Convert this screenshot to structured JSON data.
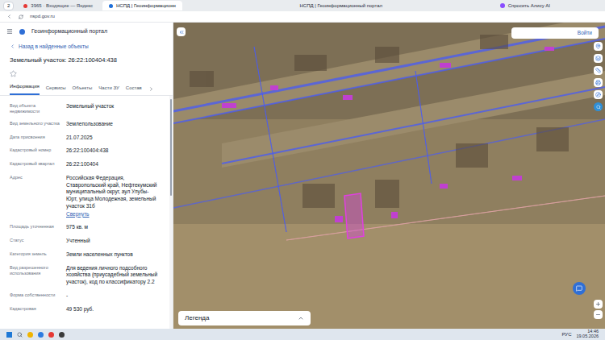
{
  "browser": {
    "tab_count": "2",
    "tabs": [
      {
        "label": "3965 · Входящие — Яндекс",
        "selected": false
      },
      {
        "label": "НСПД | Геоинформационн",
        "selected": true
      }
    ],
    "page_title": "НСПД | Геоинформационный портал",
    "alice": "Спросить Алису AI",
    "address": "nspd.gov.ru"
  },
  "app": {
    "title": "Геоинформационный портал",
    "back": "Назад в найденные объекты",
    "object_title": "Земельный участок: 26:22:100404:438",
    "starred": false,
    "tabs": [
      {
        "label": "Информация",
        "selected": true
      },
      {
        "label": "Сервисы",
        "selected": false
      },
      {
        "label": "Объекты",
        "selected": false
      },
      {
        "label": "Части ЗУ",
        "selected": false
      },
      {
        "label": "Состав",
        "selected": false
      }
    ],
    "fields": [
      {
        "label": "Вид объекта недвижимости",
        "value": "Земельный участок"
      },
      {
        "label": "Вид земельного участка",
        "value": "Землепользование"
      },
      {
        "label": "Дата присвоения",
        "value": "21.07.2025"
      },
      {
        "label": "Кадастровый номер",
        "value": "26:22:100404:438"
      },
      {
        "label": "Кадастровый квартал",
        "value": "26:22:100404"
      },
      {
        "label": "Адрес",
        "value": "Российская Федерация, Ставропольский край, Нефтекумский муниципальный округ, аул Улубы-Юрт, улица Молодежная, земельный участок 31б",
        "link": "Свернуть"
      },
      {
        "label": "Площадь уточненная",
        "value": "975 кв. м"
      },
      {
        "label": "Статус",
        "value": "Учтенный"
      },
      {
        "label": "Категория земель",
        "value": "Земли населенных пунктов"
      },
      {
        "label": "Вид разрешенного использования",
        "value": "Для ведения личного подсобного хозяйства (приусадебный земельный участок), код по классификатору 2.2"
      },
      {
        "label": "Форма собственности",
        "value": "-"
      },
      {
        "label": "Кадастровая",
        "value": "49 530 руб."
      }
    ]
  },
  "map": {
    "login": "Войти",
    "legend": "Легенда"
  },
  "taskbar": {
    "lang": "РУС",
    "time": "14:46",
    "date": "19.05.2026"
  }
}
